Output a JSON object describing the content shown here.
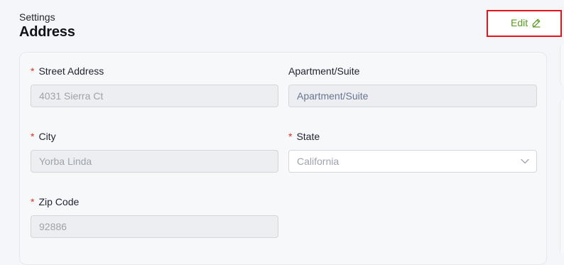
{
  "header": {
    "breadcrumb": "Settings",
    "title": "Address",
    "edit_label": "Edit"
  },
  "form": {
    "street_address": {
      "label": "Street Address",
      "required_mark": "*",
      "value": "4031 Sierra Ct"
    },
    "apartment_suite": {
      "label": "Apartment/Suite",
      "placeholder": "Apartment/Suite"
    },
    "city": {
      "label": "City",
      "required_mark": "*",
      "value": "Yorba Linda"
    },
    "state": {
      "label": "State",
      "required_mark": "*",
      "value": "California"
    },
    "zip_code": {
      "label": "Zip Code",
      "required_mark": "*",
      "value": "92886"
    }
  },
  "icons": {
    "edit": "pencil-icon",
    "state_dropdown": "chevron-down-icon"
  },
  "colors": {
    "page_background": "#f5f6f9",
    "edit_text": "#5a9a1e",
    "highlight_border": "#e8121b",
    "required_asterisk": "#e0301e"
  }
}
